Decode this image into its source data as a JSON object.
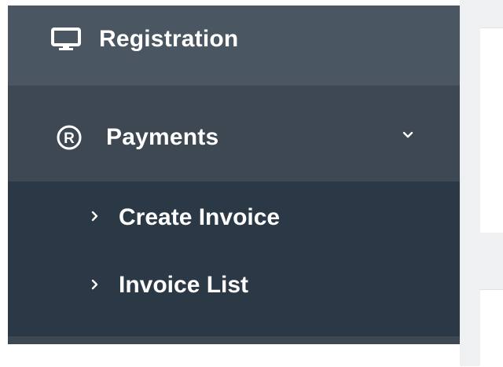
{
  "sidebar": {
    "registration": {
      "label": "Registration",
      "icon": "monitor-icon"
    },
    "payments": {
      "label": "Payments",
      "icon": "registered-icon",
      "expanded": true
    },
    "submenu": [
      {
        "label": "Create Invoice"
      },
      {
        "label": "Invoice List"
      }
    ]
  },
  "colors": {
    "sidebar_bg": "#3d4852",
    "registration_bg": "#4a5661",
    "submenu_bg": "#2b3845",
    "text": "#ffffff",
    "content_bg": "#eef0f2"
  }
}
